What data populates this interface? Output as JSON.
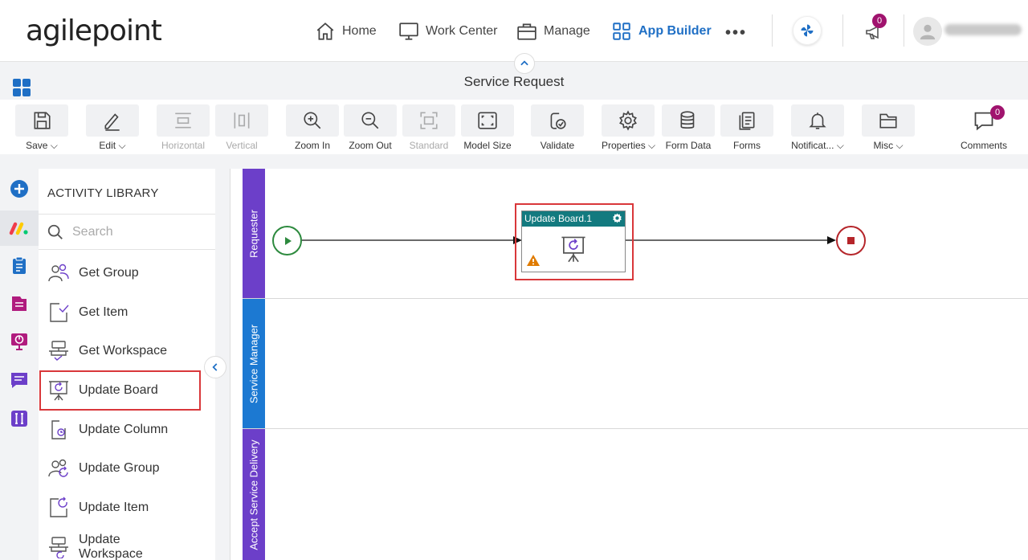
{
  "brand": {
    "logo_text": "agilepoint"
  },
  "nav": {
    "items": [
      {
        "label": "Home",
        "icon": "home-icon"
      },
      {
        "label": "Work Center",
        "icon": "monitor-icon"
      },
      {
        "label": "Manage",
        "icon": "briefcase-icon"
      },
      {
        "label": "App Builder",
        "icon": "grid-icon",
        "active": true
      }
    ],
    "more_label": "•••",
    "announcements_count": "0",
    "accent": "#1f6fc5",
    "badge_color": "#a0136e"
  },
  "page": {
    "title": "Service Request"
  },
  "toolbar": {
    "save": "Save",
    "edit": "Edit",
    "horizontal": "Horizontal",
    "vertical": "Vertical",
    "zoom_in": "Zoom In",
    "zoom_out": "Zoom Out",
    "standard": "Standard",
    "model_size": "Model Size",
    "validate": "Validate",
    "properties": "Properties",
    "form_data": "Form Data",
    "forms": "Forms",
    "notifications": "Notificat...",
    "misc": "Misc",
    "comments": "Comments",
    "comments_count": "0"
  },
  "library": {
    "title": "ACTIVITY LIBRARY",
    "search_placeholder": "Search",
    "items": [
      {
        "label": "Get Group",
        "icon": "group-icon"
      },
      {
        "label": "Get Item",
        "icon": "item-check-icon"
      },
      {
        "label": "Get Workspace",
        "icon": "workspace-icon"
      },
      {
        "label": "Update Board",
        "icon": "board-refresh-icon",
        "selected": true
      },
      {
        "label": "Update Column",
        "icon": "column-icon"
      },
      {
        "label": "Update Group",
        "icon": "group-refresh-icon"
      },
      {
        "label": "Update Item",
        "icon": "item-refresh-icon"
      },
      {
        "label": "Update",
        "label2": "Workspace",
        "icon": "workspace-refresh-icon"
      }
    ]
  },
  "lanes": [
    {
      "label": "Requester",
      "color": "#6c3fc9"
    },
    {
      "label": "Service Manager",
      "color": "#1c79d2"
    },
    {
      "label": "Accept Service Delivery",
      "color": "#6c3fc9"
    }
  ],
  "process": {
    "activity_title": "Update Board.1",
    "header_color": "#137a7f",
    "start_color": "#2d8a3e",
    "end_color": "#b5252a"
  }
}
